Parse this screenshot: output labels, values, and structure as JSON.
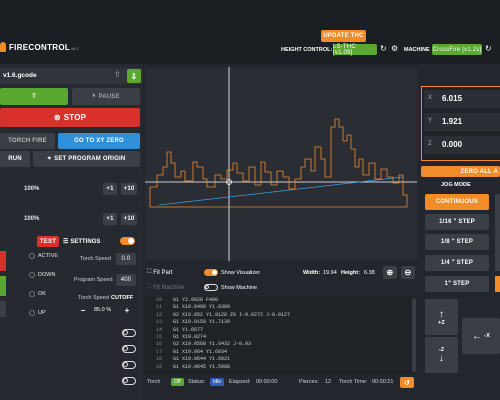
{
  "app": {
    "logo_text": "FIRECONTROL",
    "logo_version": "v5.1"
  },
  "header": {
    "update_label": "UPDATE THC",
    "height_control_label": "HEIGHT CONTROL:",
    "height_control_value": "LS-THC [v1.09]",
    "machine_label": "MACHINE",
    "machine_value": "CrossFire [v1.2s]"
  },
  "file": {
    "name": "v1.6.gcode"
  },
  "left": {
    "run_label": "T",
    "pause_label": "PAUSE",
    "stop_label": "STOP",
    "torch_fire_label": "TORCH FIRE",
    "go_xy_zero_label": "GO TO XY ZERO",
    "dry_run_label": "RUN",
    "set_origin_label": "SET PROGRAM ORIGIN",
    "overrides": [
      {
        "value": "100%",
        "btn1": "+1",
        "btn2": "+10"
      },
      {
        "value": "100%",
        "btn1": "+1",
        "btn2": "+10"
      }
    ],
    "test_label": "TEST",
    "settings_label": "SETTINGS",
    "thc_states": [
      "ACTIVE",
      "DOWN",
      "OK",
      "UP"
    ],
    "torch_speed_label": "Torch Speed",
    "torch_speed_value": "0.0",
    "program_speed_label": "Program Speed",
    "program_speed_value": "400",
    "cutoff_label": "Torch Speed",
    "cutoff_value": "CUTOFF",
    "cutoff_minus": "−",
    "cutoff_percent": "85.0 %",
    "cutoff_plus": "+"
  },
  "visualizer": {
    "fit_part_label": "Fit Part",
    "fit_machine_label": "Fit Machine",
    "show_visualizer_label": "Show Visualizer",
    "show_machine_label": "Show Machine",
    "width_label": "Width:",
    "width_value": "19.94",
    "height_label": "Height:",
    "height_value": "6.38"
  },
  "gcode": {
    "lines": [
      {
        "n": "10",
        "code": "G1 Y2.0028 F400"
      },
      {
        "n": "11",
        "code": "G1 X19.0498 Y1.9309"
      },
      {
        "n": "12",
        "code": "G2 X19.052 Y1.9128 Z0 I-0.0272 J-0.0127"
      },
      {
        "n": "13",
        "code": "G1 X19.0159 Y1.7139"
      },
      {
        "n": "14",
        "code": "G1 Y1.6677"
      },
      {
        "n": "15",
        "code": "G1 X19.0274"
      },
      {
        "n": "16",
        "code": "G2 X19.0568 Y1.6432 J-0.03"
      },
      {
        "n": "17",
        "code": "G1 X19.064 Y1.6034"
      },
      {
        "n": "18",
        "code": "G1 X19.0644 Y1.6021"
      },
      {
        "n": "19",
        "code": "G1 X19.0645 Y1.5988"
      }
    ]
  },
  "status": {
    "torch_label": "Torch",
    "torch_value": "Off",
    "status_label": "Status:",
    "status_value": "Idle",
    "elapsed_label": "Elapsed:",
    "elapsed_value": "00:00:00",
    "pierces_label": "Pierces:",
    "pierces_value": "12",
    "torch_time_label": "Torch Time:",
    "torch_time_value": "00:00:21"
  },
  "dro": {
    "axes": [
      {
        "axis": "X",
        "value": "6.015"
      },
      {
        "axis": "Y",
        "value": "1.921"
      },
      {
        "axis": "Z",
        "value": "0.000"
      }
    ],
    "zero_all_label": "ZERO ALL A"
  },
  "jog": {
    "mode_label": "JOG MODE",
    "modes": [
      "CONTINUOUS",
      "1/16 \" STEP",
      "1/8 \" STEP",
      "1/4 \" STEP",
      "1\" STEP"
    ],
    "z_up_label": "+Z",
    "z_down_label": "-Z",
    "x_minus_label": "-X"
  },
  "colors": {
    "accent": "#f28c28",
    "green": "#5aa830",
    "red": "#d9302c",
    "blue": "#2f8fd8"
  }
}
